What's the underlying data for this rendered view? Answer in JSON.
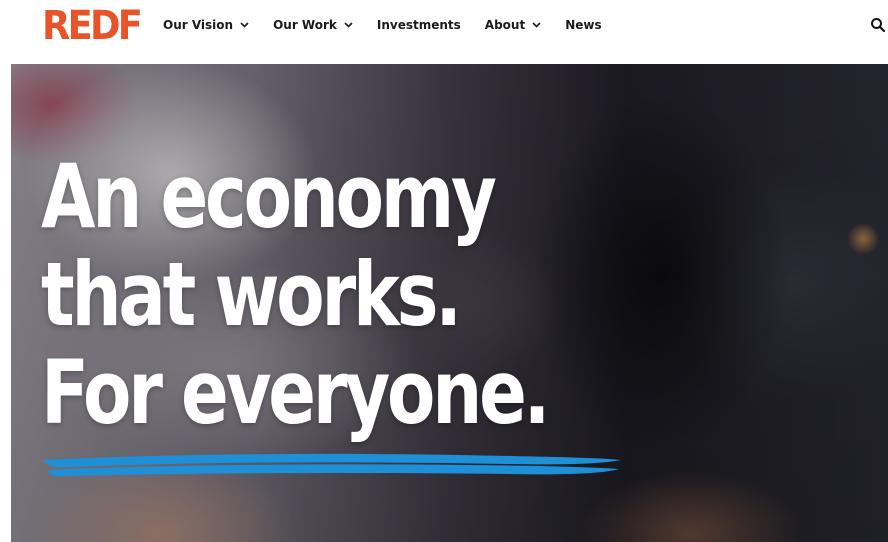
{
  "brand": {
    "logo_text": "REDF",
    "logo_color": "#e8542a"
  },
  "nav": {
    "items": [
      {
        "label": "Our Vision",
        "has_dropdown": true
      },
      {
        "label": "Our Work",
        "has_dropdown": true
      },
      {
        "label": "Investments",
        "has_dropdown": false
      },
      {
        "label": "About",
        "has_dropdown": true
      },
      {
        "label": "News",
        "has_dropdown": false
      }
    ],
    "search_icon": "search-icon",
    "dropdown_icon": "chevron-down-icon"
  },
  "hero": {
    "headline_line1": "An economy",
    "headline_line2": "that works.",
    "headline_line3": "For everyone.",
    "headline_color": "#ffffff",
    "underline_color": "#1e90d8"
  }
}
